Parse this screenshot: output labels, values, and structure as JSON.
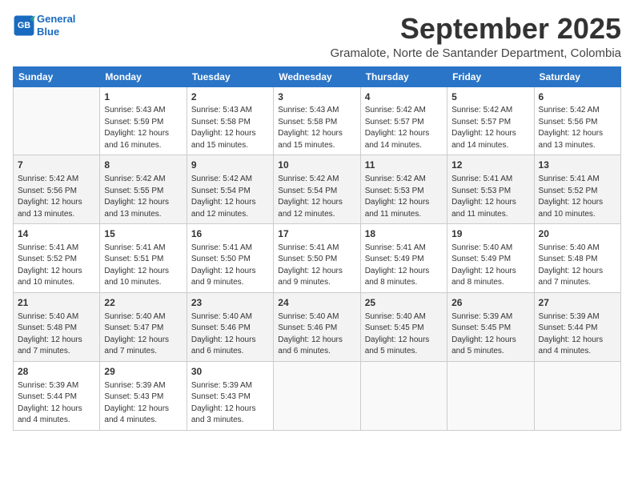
{
  "logo": {
    "line1": "General",
    "line2": "Blue"
  },
  "title": "September 2025",
  "subtitle": "Gramalote, Norte de Santander Department, Colombia",
  "days_of_week": [
    "Sunday",
    "Monday",
    "Tuesday",
    "Wednesday",
    "Thursday",
    "Friday",
    "Saturday"
  ],
  "weeks": [
    [
      {
        "num": "",
        "info": ""
      },
      {
        "num": "1",
        "info": "Sunrise: 5:43 AM\nSunset: 5:59 PM\nDaylight: 12 hours\nand 16 minutes."
      },
      {
        "num": "2",
        "info": "Sunrise: 5:43 AM\nSunset: 5:58 PM\nDaylight: 12 hours\nand 15 minutes."
      },
      {
        "num": "3",
        "info": "Sunrise: 5:43 AM\nSunset: 5:58 PM\nDaylight: 12 hours\nand 15 minutes."
      },
      {
        "num": "4",
        "info": "Sunrise: 5:42 AM\nSunset: 5:57 PM\nDaylight: 12 hours\nand 14 minutes."
      },
      {
        "num": "5",
        "info": "Sunrise: 5:42 AM\nSunset: 5:57 PM\nDaylight: 12 hours\nand 14 minutes."
      },
      {
        "num": "6",
        "info": "Sunrise: 5:42 AM\nSunset: 5:56 PM\nDaylight: 12 hours\nand 13 minutes."
      }
    ],
    [
      {
        "num": "7",
        "info": "Sunrise: 5:42 AM\nSunset: 5:56 PM\nDaylight: 12 hours\nand 13 minutes."
      },
      {
        "num": "8",
        "info": "Sunrise: 5:42 AM\nSunset: 5:55 PM\nDaylight: 12 hours\nand 13 minutes."
      },
      {
        "num": "9",
        "info": "Sunrise: 5:42 AM\nSunset: 5:54 PM\nDaylight: 12 hours\nand 12 minutes."
      },
      {
        "num": "10",
        "info": "Sunrise: 5:42 AM\nSunset: 5:54 PM\nDaylight: 12 hours\nand 12 minutes."
      },
      {
        "num": "11",
        "info": "Sunrise: 5:42 AM\nSunset: 5:53 PM\nDaylight: 12 hours\nand 11 minutes."
      },
      {
        "num": "12",
        "info": "Sunrise: 5:41 AM\nSunset: 5:53 PM\nDaylight: 12 hours\nand 11 minutes."
      },
      {
        "num": "13",
        "info": "Sunrise: 5:41 AM\nSunset: 5:52 PM\nDaylight: 12 hours\nand 10 minutes."
      }
    ],
    [
      {
        "num": "14",
        "info": "Sunrise: 5:41 AM\nSunset: 5:52 PM\nDaylight: 12 hours\nand 10 minutes."
      },
      {
        "num": "15",
        "info": "Sunrise: 5:41 AM\nSunset: 5:51 PM\nDaylight: 12 hours\nand 10 minutes."
      },
      {
        "num": "16",
        "info": "Sunrise: 5:41 AM\nSunset: 5:50 PM\nDaylight: 12 hours\nand 9 minutes."
      },
      {
        "num": "17",
        "info": "Sunrise: 5:41 AM\nSunset: 5:50 PM\nDaylight: 12 hours\nand 9 minutes."
      },
      {
        "num": "18",
        "info": "Sunrise: 5:41 AM\nSunset: 5:49 PM\nDaylight: 12 hours\nand 8 minutes."
      },
      {
        "num": "19",
        "info": "Sunrise: 5:40 AM\nSunset: 5:49 PM\nDaylight: 12 hours\nand 8 minutes."
      },
      {
        "num": "20",
        "info": "Sunrise: 5:40 AM\nSunset: 5:48 PM\nDaylight: 12 hours\nand 7 minutes."
      }
    ],
    [
      {
        "num": "21",
        "info": "Sunrise: 5:40 AM\nSunset: 5:48 PM\nDaylight: 12 hours\nand 7 minutes."
      },
      {
        "num": "22",
        "info": "Sunrise: 5:40 AM\nSunset: 5:47 PM\nDaylight: 12 hours\nand 7 minutes."
      },
      {
        "num": "23",
        "info": "Sunrise: 5:40 AM\nSunset: 5:46 PM\nDaylight: 12 hours\nand 6 minutes."
      },
      {
        "num": "24",
        "info": "Sunrise: 5:40 AM\nSunset: 5:46 PM\nDaylight: 12 hours\nand 6 minutes."
      },
      {
        "num": "25",
        "info": "Sunrise: 5:40 AM\nSunset: 5:45 PM\nDaylight: 12 hours\nand 5 minutes."
      },
      {
        "num": "26",
        "info": "Sunrise: 5:39 AM\nSunset: 5:45 PM\nDaylight: 12 hours\nand 5 minutes."
      },
      {
        "num": "27",
        "info": "Sunrise: 5:39 AM\nSunset: 5:44 PM\nDaylight: 12 hours\nand 4 minutes."
      }
    ],
    [
      {
        "num": "28",
        "info": "Sunrise: 5:39 AM\nSunset: 5:44 PM\nDaylight: 12 hours\nand 4 minutes."
      },
      {
        "num": "29",
        "info": "Sunrise: 5:39 AM\nSunset: 5:43 PM\nDaylight: 12 hours\nand 4 minutes."
      },
      {
        "num": "30",
        "info": "Sunrise: 5:39 AM\nSunset: 5:43 PM\nDaylight: 12 hours\nand 3 minutes."
      },
      {
        "num": "",
        "info": ""
      },
      {
        "num": "",
        "info": ""
      },
      {
        "num": "",
        "info": ""
      },
      {
        "num": "",
        "info": ""
      }
    ]
  ]
}
